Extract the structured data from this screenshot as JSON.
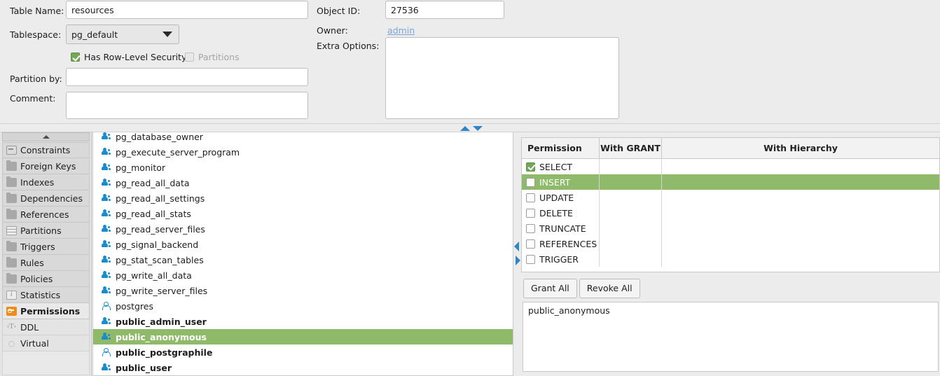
{
  "form": {
    "table_name_label": "Table Name:",
    "table_name_value": "resources",
    "tablespace_label": "Tablespace:",
    "tablespace_value": "pg_default",
    "rls_label": "Has Row-Level Security",
    "partitions_label": "Partitions",
    "partition_by_label": "Partition by:",
    "partition_by_value": "",
    "comment_label": "Comment:",
    "comment_value": "",
    "object_id_label": "Object ID:",
    "object_id_value": "27536",
    "owner_label": "Owner:",
    "owner_value": "admin",
    "extra_options_label": "Extra Options:",
    "extra_options_value": ""
  },
  "sidebar": {
    "items": [
      {
        "label": "Constraints",
        "icon": "constraint-icon",
        "selected": false,
        "style": "panel"
      },
      {
        "label": "Foreign Keys",
        "icon": "folder-icon",
        "selected": false,
        "style": "panel"
      },
      {
        "label": "Indexes",
        "icon": "folder-icon",
        "selected": false,
        "style": "panel"
      },
      {
        "label": "Dependencies",
        "icon": "folder-icon",
        "selected": false,
        "style": "panel"
      },
      {
        "label": "References",
        "icon": "folder-icon",
        "selected": false,
        "style": "panel"
      },
      {
        "label": "Partitions",
        "icon": "partitions-icon",
        "selected": false,
        "style": "panel"
      },
      {
        "label": "Triggers",
        "icon": "folder-icon",
        "selected": false,
        "style": "panel"
      },
      {
        "label": "Rules",
        "icon": "folder-icon",
        "selected": false,
        "style": "panel"
      },
      {
        "label": "Policies",
        "icon": "folder-icon",
        "selected": false,
        "style": "panel"
      },
      {
        "label": "Statistics",
        "icon": "info-icon",
        "selected": false,
        "style": "panel"
      },
      {
        "label": "Permissions",
        "icon": "key-icon",
        "selected": true,
        "style": "panel"
      },
      {
        "label": "DDL",
        "icon": "ddl-icon",
        "selected": false,
        "style": "plain"
      },
      {
        "label": "Virtual",
        "icon": "virtual-icon",
        "selected": false,
        "style": "plain"
      }
    ]
  },
  "roles": {
    "items": [
      {
        "label": "pg_database_owner",
        "icon": "group-icon",
        "selected": false,
        "bold": false
      },
      {
        "label": "pg_execute_server_program",
        "icon": "group-icon",
        "selected": false,
        "bold": false
      },
      {
        "label": "pg_monitor",
        "icon": "group-icon",
        "selected": false,
        "bold": false
      },
      {
        "label": "pg_read_all_data",
        "icon": "group-icon",
        "selected": false,
        "bold": false
      },
      {
        "label": "pg_read_all_settings",
        "icon": "group-icon",
        "selected": false,
        "bold": false
      },
      {
        "label": "pg_read_all_stats",
        "icon": "group-icon",
        "selected": false,
        "bold": false
      },
      {
        "label": "pg_read_server_files",
        "icon": "group-icon",
        "selected": false,
        "bold": false
      },
      {
        "label": "pg_signal_backend",
        "icon": "group-icon",
        "selected": false,
        "bold": false
      },
      {
        "label": "pg_stat_scan_tables",
        "icon": "group-icon",
        "selected": false,
        "bold": false
      },
      {
        "label": "pg_write_all_data",
        "icon": "group-icon",
        "selected": false,
        "bold": false
      },
      {
        "label": "pg_write_server_files",
        "icon": "group-icon",
        "selected": false,
        "bold": false
      },
      {
        "label": "postgres",
        "icon": "person-icon",
        "selected": false,
        "bold": false
      },
      {
        "label": "public_admin_user",
        "icon": "group-icon",
        "selected": false,
        "bold": true
      },
      {
        "label": "public_anonymous",
        "icon": "group-icon",
        "selected": true,
        "bold": true
      },
      {
        "label": "public_postgraphile",
        "icon": "person-icon",
        "selected": false,
        "bold": true
      },
      {
        "label": "public_user",
        "icon": "group-icon",
        "selected": false,
        "bold": true
      }
    ]
  },
  "permissions": {
    "headers": {
      "permission": "Permission",
      "with_grant": "With GRANT",
      "with_hierarchy": "With Hierarchy"
    },
    "rows": [
      {
        "label": "SELECT",
        "checked": true,
        "selected": false,
        "with_grant": "",
        "with_hierarchy": ""
      },
      {
        "label": "INSERT",
        "checked": false,
        "selected": true,
        "with_grant": "",
        "with_hierarchy": ""
      },
      {
        "label": "UPDATE",
        "checked": false,
        "selected": false,
        "with_grant": "",
        "with_hierarchy": ""
      },
      {
        "label": "DELETE",
        "checked": false,
        "selected": false,
        "with_grant": "",
        "with_hierarchy": ""
      },
      {
        "label": "TRUNCATE",
        "checked": false,
        "selected": false,
        "with_grant": "",
        "with_hierarchy": ""
      },
      {
        "label": "REFERENCES",
        "checked": false,
        "selected": false,
        "with_grant": "",
        "with_hierarchy": ""
      },
      {
        "label": "TRIGGER",
        "checked": false,
        "selected": false,
        "with_grant": "",
        "with_hierarchy": ""
      }
    ]
  },
  "buttons": {
    "grant_all": "Grant All",
    "revoke_all": "Revoke All"
  },
  "bottom": {
    "text": "public_anonymous"
  },
  "colors": {
    "selection_green": "#8fba69",
    "checkbox_green": "#74a858",
    "role_icon_blue": "#1a8ccc",
    "link_blue": "#7aa7d6",
    "key_orange": "#ef8b17",
    "splitter_arrow_blue": "#2e86c8",
    "window_bg": "#ececec"
  }
}
